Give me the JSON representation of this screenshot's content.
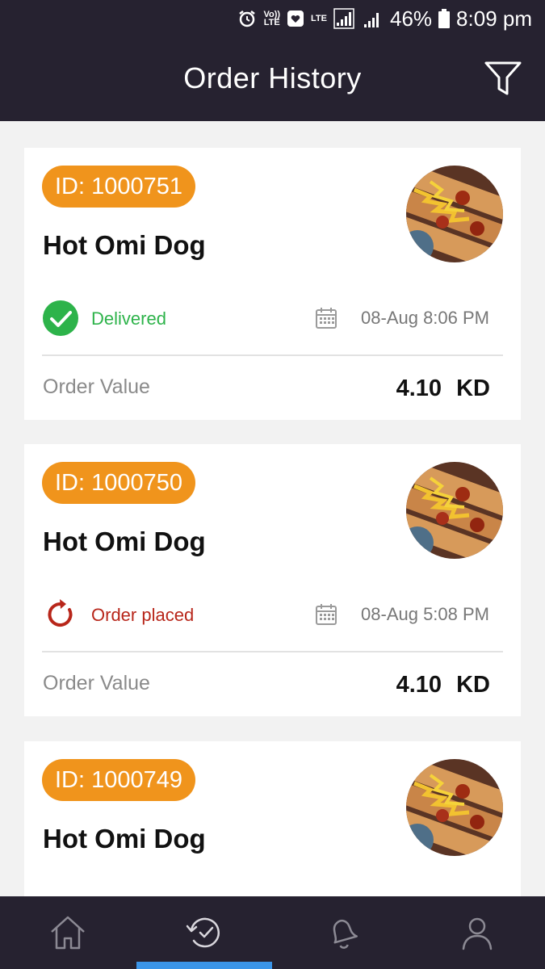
{
  "status_bar": {
    "volte_top": "Vo))",
    "volte_bottom": "LTE",
    "lte": "LTE",
    "battery": "46%",
    "time": "8:09 pm"
  },
  "header": {
    "title": "Order History",
    "filter_icon": "filter-icon"
  },
  "orders": [
    {
      "id_label": "ID: 1000751",
      "name": "Hot Omi Dog",
      "status": "Delivered",
      "status_icon": "check-circle-icon",
      "status_color": "#2db34a",
      "date": "08-Aug 8:06 PM",
      "value_label": "Order Value",
      "value": "4.10 KD"
    },
    {
      "id_label": "ID: 1000750",
      "name": "Hot Omi Dog",
      "status": "Order placed",
      "status_icon": "refresh-icon",
      "status_color": "#b8261a",
      "date": "08-Aug 5:08 PM",
      "value_label": "Order Value",
      "value": "4.10 KD"
    },
    {
      "id_label": "ID: 1000749",
      "name": "Hot Omi Dog"
    }
  ],
  "bottom_nav": [
    {
      "icon": "home-icon",
      "active": false
    },
    {
      "icon": "order-history-icon",
      "active": true
    },
    {
      "icon": "notification-bell-icon",
      "active": false
    },
    {
      "icon": "profile-icon",
      "active": false
    }
  ],
  "colors": {
    "header_bg": "#262230",
    "badge": "#f0941c",
    "active_tab": "#3b95e8"
  }
}
